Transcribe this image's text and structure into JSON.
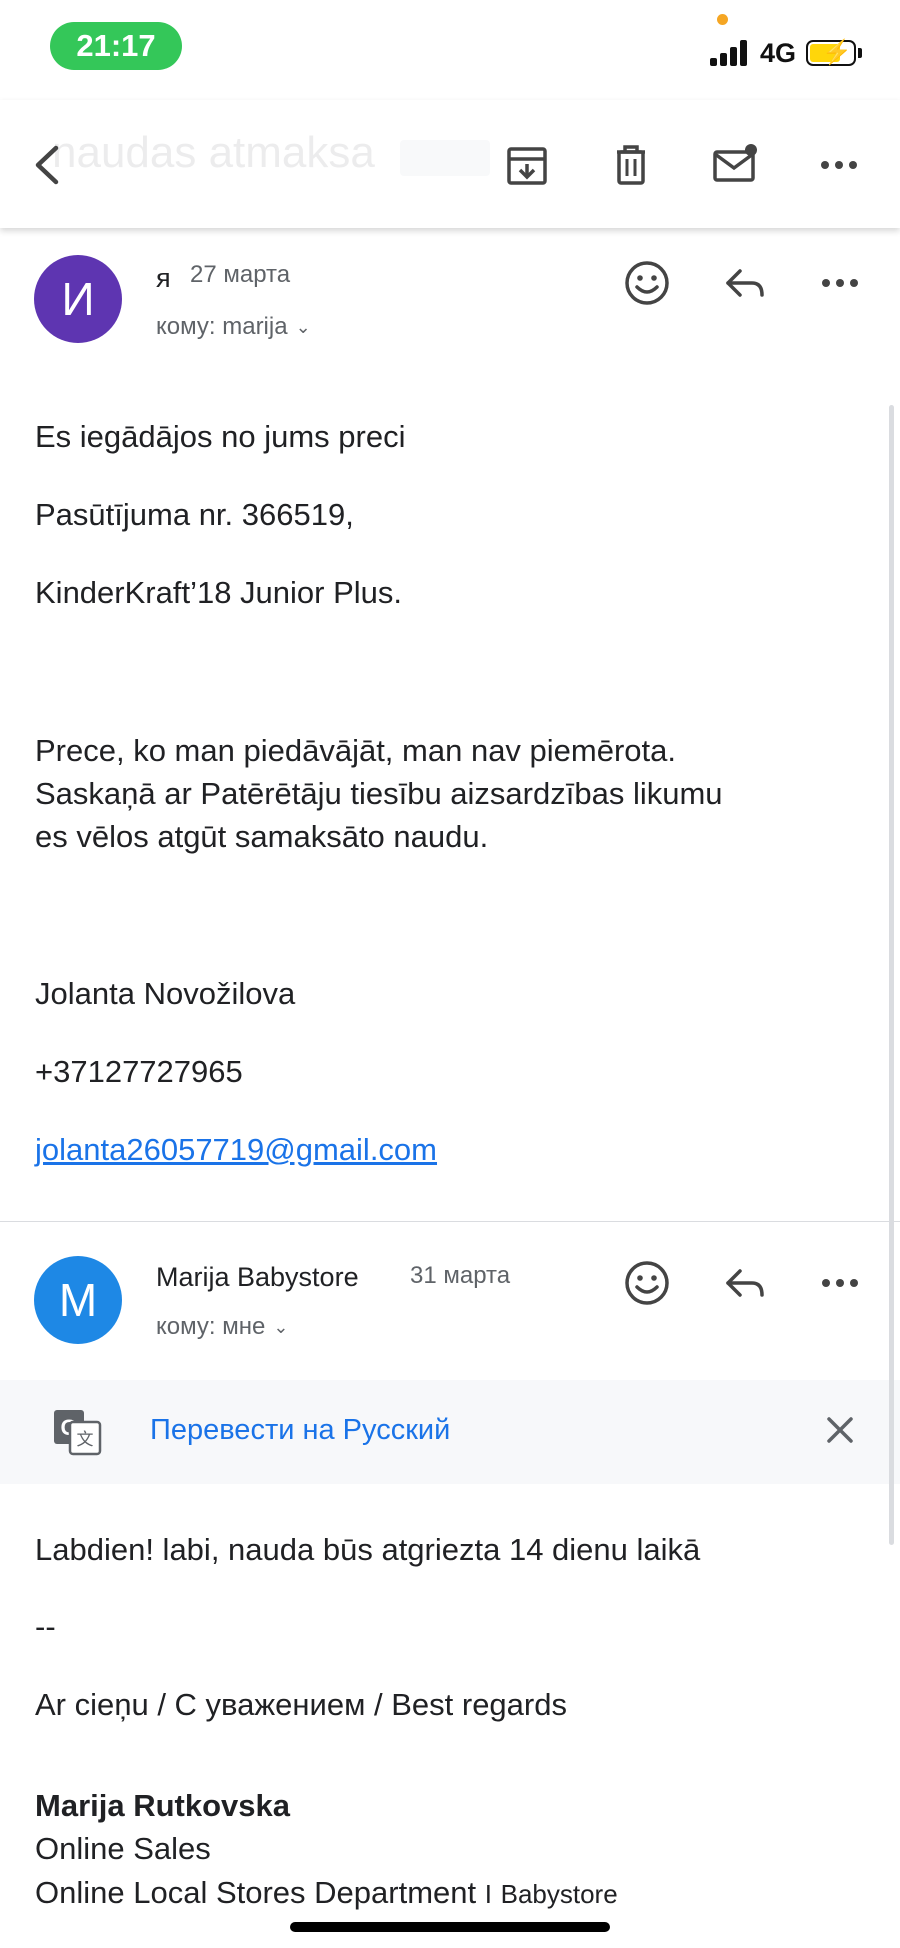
{
  "status_bar": {
    "time": "21:17",
    "network": "4G",
    "accent_color": "#34c759"
  },
  "toolbar": {
    "subject_faded": "naudas atmaksa",
    "icons": [
      "back-icon",
      "archive-icon",
      "trash-icon",
      "mark-unread-icon",
      "more-icon"
    ]
  },
  "message1": {
    "avatar_letter": "И",
    "avatar_color": "#5e35b1",
    "sender": "я",
    "date": "27 марта",
    "recipient": "кому: marija",
    "body": [
      "Es iegādājos no jums preci",
      "Pasūtījuma nr. 366519,",
      "KinderKraft’18 Junior Plus.",
      "Prece, ko man piedāvājāt, man nav piemērota.",
      "Saskaņā ar Patērētāju tiesību aizsardzības likumu",
      "es vēlos atgūt samaksāto naudu.",
      "Jolanta Novožilova",
      "+37127727965"
    ],
    "email_link": "jolanta26057719@gmail.com"
  },
  "message2": {
    "avatar_letter": "M",
    "avatar_color": "#1e88e5",
    "sender": "Marija Babystore",
    "date": "31 марта",
    "recipient": "кому: мне",
    "translate_label": "Перевести на Русский",
    "body": [
      "Labdien! labi, nauda būs atgriezta 14 dienu laikā",
      "--",
      "Ar cieņu / С уважением / Best regards"
    ],
    "signature": {
      "name": "Marija Rutkovska",
      "title": "Online Sales",
      "department": "Online Local Stores Department",
      "separator": "I",
      "brand": "Babystore"
    }
  }
}
